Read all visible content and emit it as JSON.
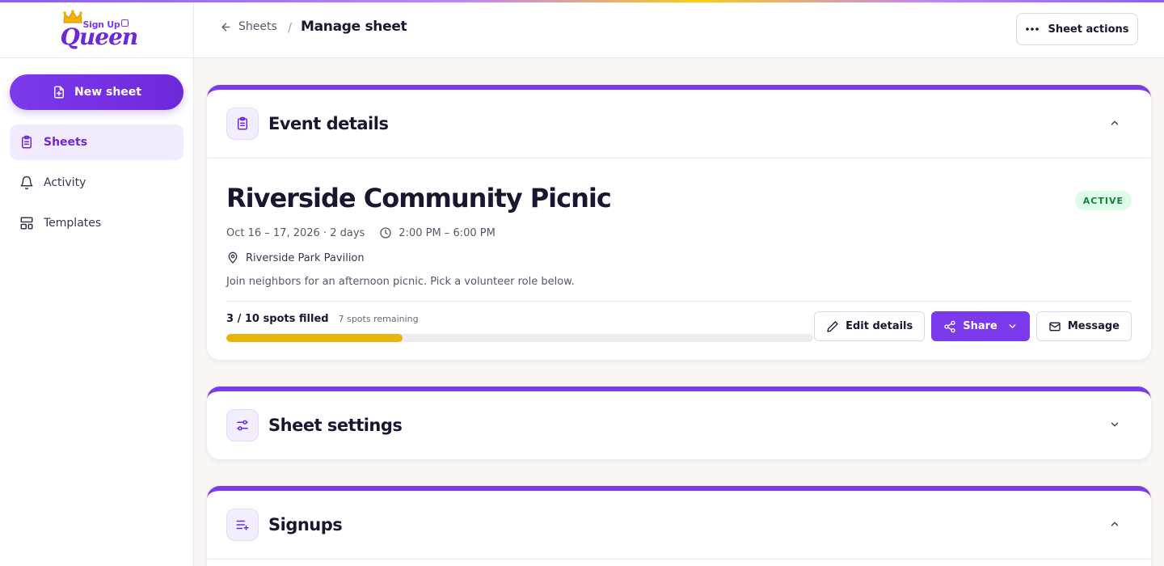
{
  "app": {
    "logo_small": "Sign Up",
    "logo_big": "Queen",
    "accent": "#7c3aed"
  },
  "sidebar": {
    "new_sheet_label": "New sheet",
    "items": [
      {
        "label": "Sheets",
        "icon": "clipboard-icon",
        "active": true
      },
      {
        "label": "Activity",
        "icon": "bell-icon",
        "active": false
      },
      {
        "label": "Templates",
        "icon": "layout-icon",
        "active": false
      }
    ]
  },
  "header": {
    "back_label": "Sheets",
    "separator": "/",
    "title": "Manage sheet",
    "actions_label": "Sheet actions"
  },
  "event_card": {
    "title": "Event details",
    "event_name": "Riverside Community Picnic",
    "status": "ACTIVE",
    "dates": "Oct 16 – 17, 2026 · 2 days",
    "time": "2:00 PM – 6:00 PM",
    "location": "Riverside Park Pavilion",
    "description": "Join neighbors for an afternoon picnic. Pick a volunteer role below.",
    "spots_filled": "3 / 10 spots filled",
    "spots_remaining": "7 spots remaining",
    "progress_fraction": 0.3,
    "edit_label": "Edit details",
    "share_label": "Share",
    "message_label": "Message",
    "status_color": "#15803d",
    "progress_color": "#eab308"
  },
  "settings_card": {
    "title": "Sheet settings"
  },
  "signups_card": {
    "title": "Signups"
  }
}
